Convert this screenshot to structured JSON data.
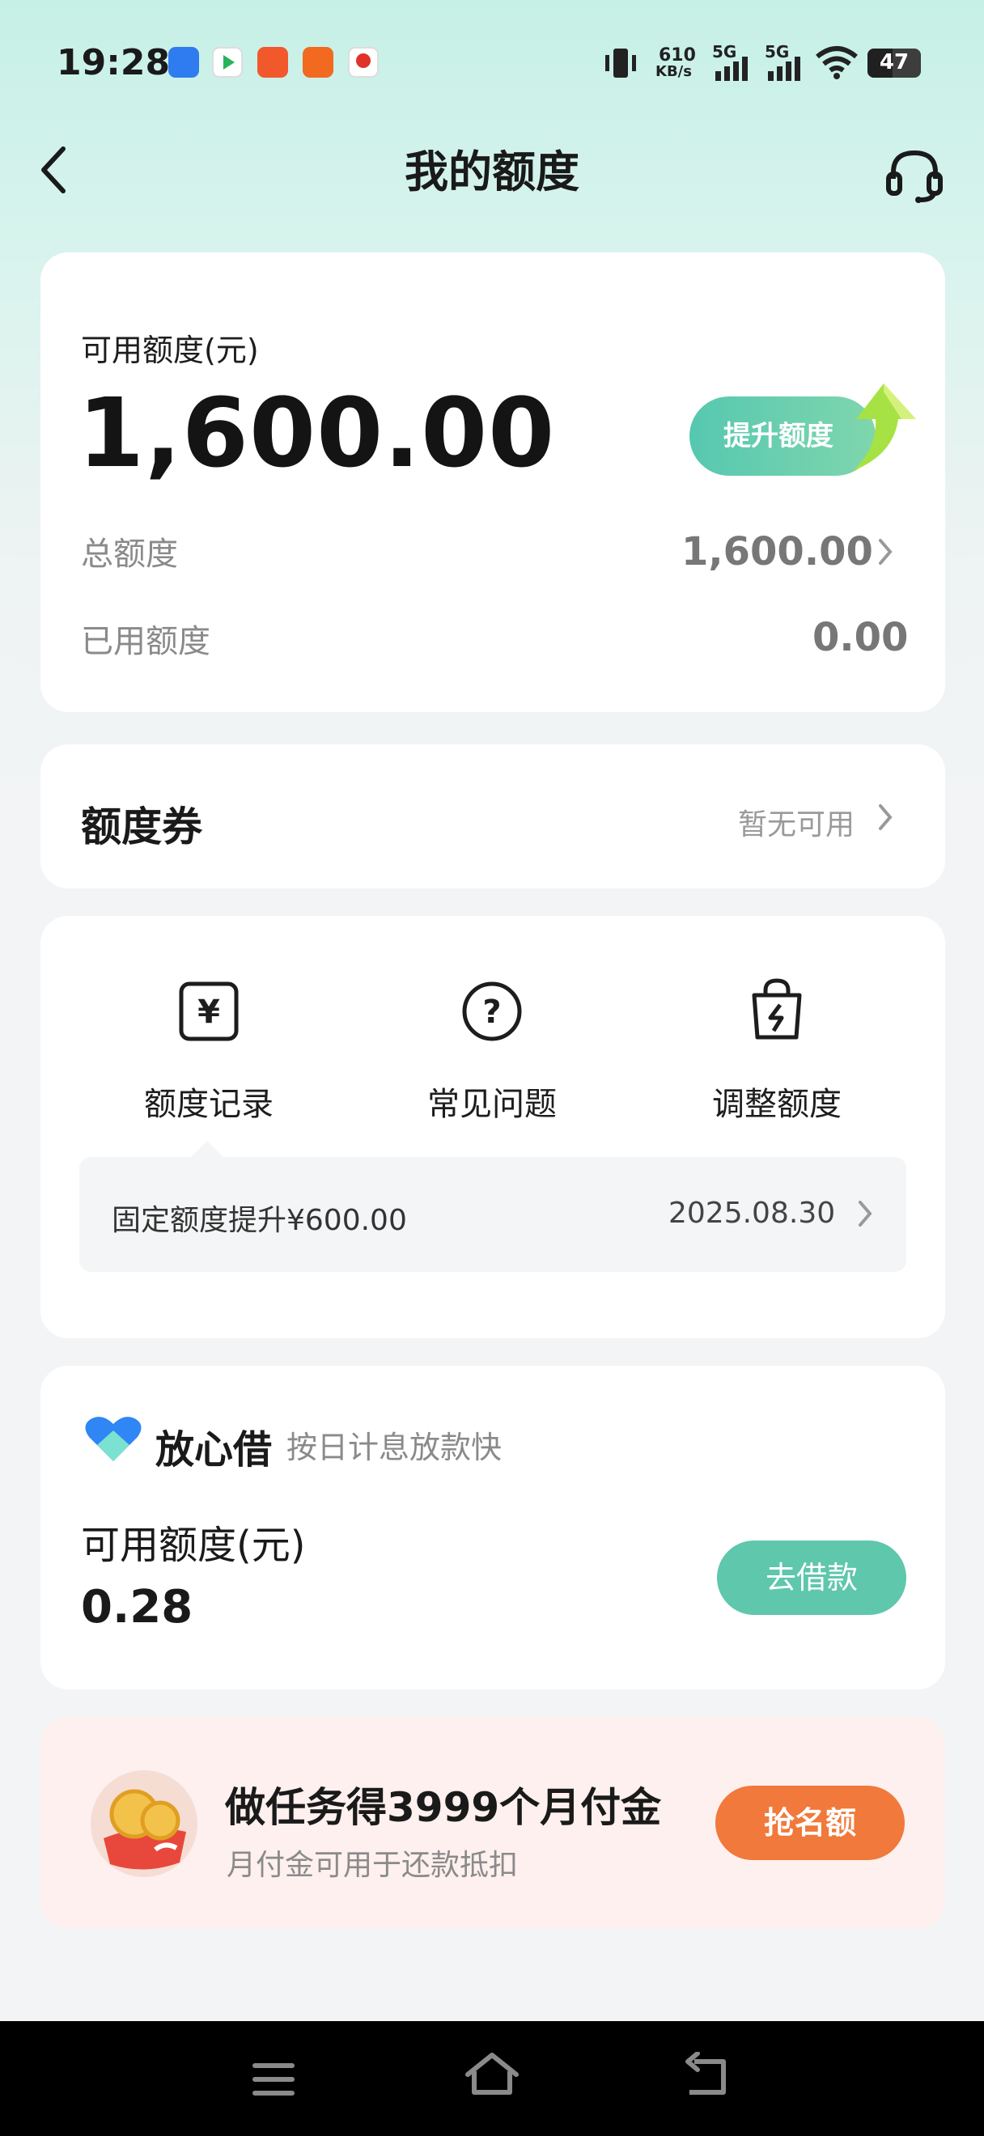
{
  "status_bar": {
    "time": "19:28",
    "net_speed_value": "610",
    "net_speed_unit": "KB/s",
    "signal_1": "5G",
    "signal_2": "5G",
    "battery": "47"
  },
  "header": {
    "title": "我的额度"
  },
  "quota_card": {
    "available_label": "可用额度(元)",
    "available_amount": "1,600.00",
    "raise_button": "提升额度",
    "total_label": "总额度",
    "total_value": "1,600.00",
    "used_label": "已用额度",
    "used_value": "0.00"
  },
  "coupon_card": {
    "title": "额度券",
    "status": "暂无可用"
  },
  "shortcuts": {
    "items": [
      {
        "label": "额度记录",
        "icon": "yen-note-icon"
      },
      {
        "label": "常见问题",
        "icon": "question-circle-icon"
      },
      {
        "label": "调整额度",
        "icon": "lightning-bag-icon"
      }
    ],
    "yen_glyph": "¥",
    "question_glyph": "?",
    "notice_text": "固定额度提升¥600.00",
    "notice_date": "2025.08.30"
  },
  "loan_card": {
    "brand": "放心借",
    "slogan": "按日计息放款快",
    "available_label": "可用额度(元)",
    "available_amount": "0.28",
    "button": "去借款"
  },
  "promo_card": {
    "title": "做任务得3999个月付金",
    "subtitle": "月付金可用于还款抵扣",
    "button": "抢名额"
  },
  "colors": {
    "accent": "#5ec7ac",
    "promo_button": "#f0793b",
    "promo_background": "#fdf0ee"
  }
}
